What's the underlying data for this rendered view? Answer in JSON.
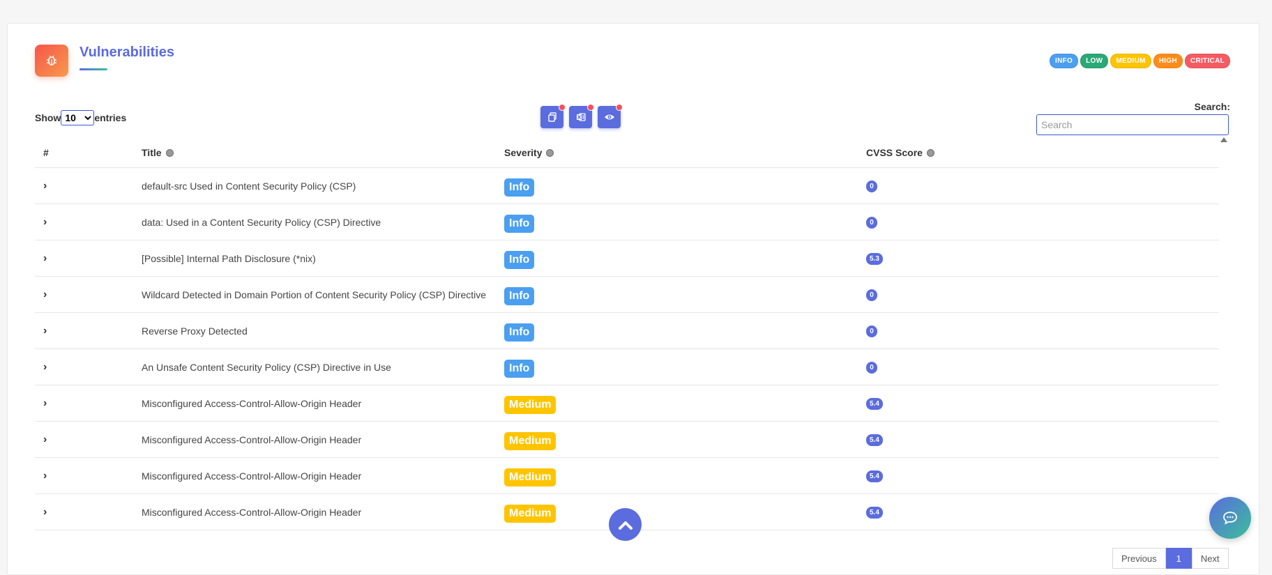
{
  "header": {
    "title": "Vulnerabilities",
    "icon": "bug-icon"
  },
  "legend": [
    {
      "label": "INFO",
      "color": "#4b9ff0"
    },
    {
      "label": "LOW",
      "color": "#2aa876"
    },
    {
      "label": "MEDIUM",
      "color": "#ffc400"
    },
    {
      "label": "HIGH",
      "color": "#ff8b1a"
    },
    {
      "label": "CRITICAL",
      "color": "#f45b63"
    }
  ],
  "controls": {
    "show_label": "Show",
    "entries_label": "entries",
    "entries_value": "10",
    "search_label": "Search:",
    "search_placeholder": "Search",
    "toolbar": [
      {
        "icon": "copy-icon"
      },
      {
        "icon": "excel-icon"
      },
      {
        "icon": "eye-icon"
      }
    ]
  },
  "table": {
    "columns": [
      "#",
      "Title",
      "Severity",
      "CVSS Score"
    ],
    "rows": [
      {
        "title": "default-src Used in Content Security Policy (CSP)",
        "severity": "Info",
        "cvss": "0"
      },
      {
        "title": "data: Used in a Content Security Policy (CSP) Directive",
        "severity": "Info",
        "cvss": "0"
      },
      {
        "title": "[Possible] Internal Path Disclosure (*nix)",
        "severity": "Info",
        "cvss": "5.3"
      },
      {
        "title": "Wildcard Detected in Domain Portion of Content Security Policy (CSP) Directive",
        "severity": "Info",
        "cvss": "0"
      },
      {
        "title": "Reverse Proxy Detected",
        "severity": "Info",
        "cvss": "0"
      },
      {
        "title": "An Unsafe Content Security Policy (CSP) Directive in Use",
        "severity": "Info",
        "cvss": "0"
      },
      {
        "title": "Misconfigured Access-Control-Allow-Origin Header",
        "severity": "Medium",
        "cvss": "5.4"
      },
      {
        "title": "Misconfigured Access-Control-Allow-Origin Header",
        "severity": "Medium",
        "cvss": "5.4"
      },
      {
        "title": "Misconfigured Access-Control-Allow-Origin Header",
        "severity": "Medium",
        "cvss": "5.4"
      },
      {
        "title": "Misconfigured Access-Control-Allow-Origin Header",
        "severity": "Medium",
        "cvss": "5.4"
      }
    ]
  },
  "severity_colors": {
    "Info": "#4b9ff0",
    "Medium": "#ffc400"
  },
  "pagination": {
    "previous": "Previous",
    "current": "1",
    "next": "Next"
  },
  "floating": {
    "scroll_top_icon": "chevron-up-icon",
    "chat_icon": "chat-icon"
  }
}
